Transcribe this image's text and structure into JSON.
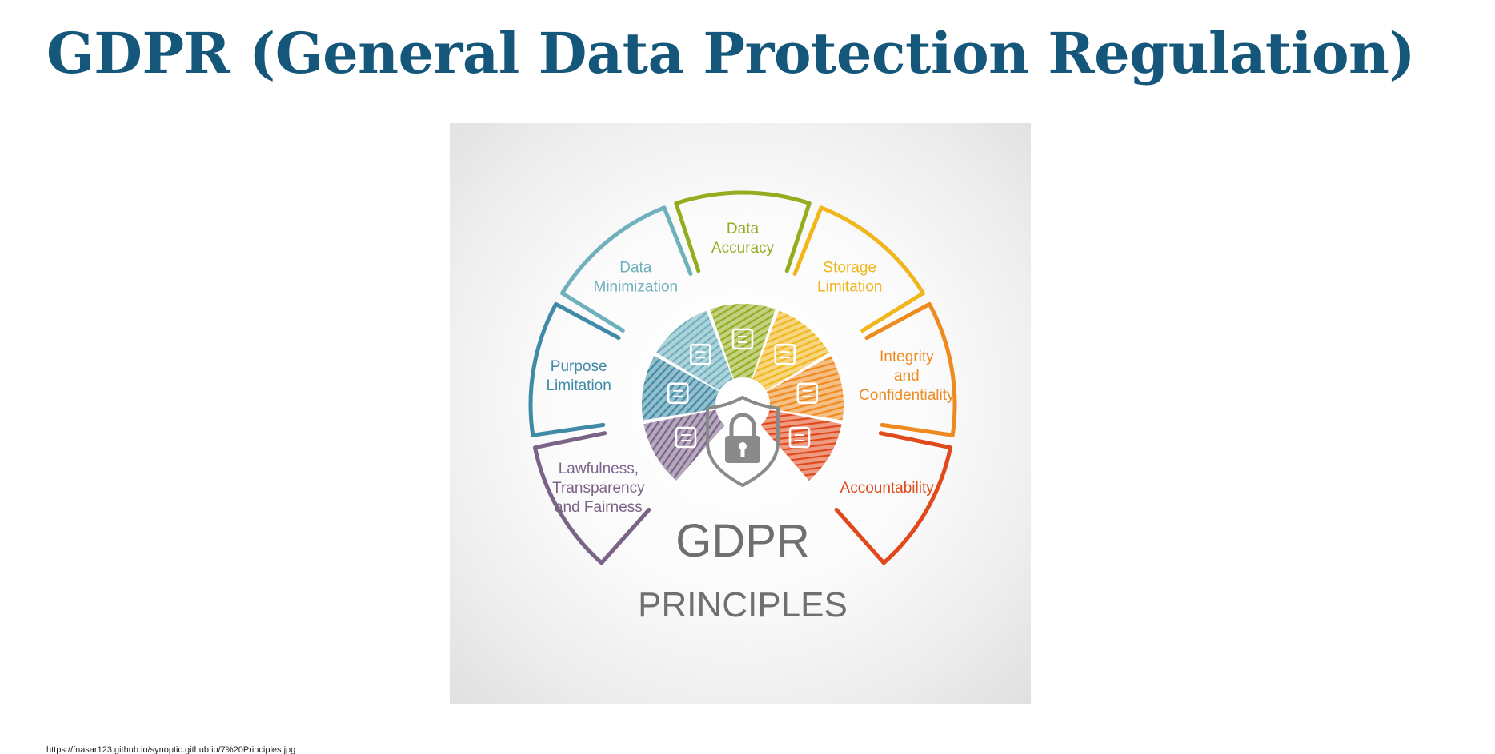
{
  "slide": {
    "title": "GDPR (General Data Protection Regulation)",
    "source_url": "https://fnasar123.github.io/synoptic.github.io/7%20Principles.jpg"
  },
  "figure": {
    "center_title": "GDPR",
    "center_subtitle": "PRINCIPLES",
    "segments": [
      {
        "label_lines": [
          "Lawfulness,",
          "Transparency",
          "and Fairness"
        ],
        "color": "#7b6388",
        "icon": "gavel-icon"
      },
      {
        "label_lines": [
          "Purpose",
          "Limitation"
        ],
        "color": "#3f8aa6",
        "icon": "clipboard-icon"
      },
      {
        "label_lines": [
          "Data",
          "Minimization"
        ],
        "color": "#6fb0bd",
        "icon": "storage-icon"
      },
      {
        "label_lines": [
          "Data",
          "Accuracy"
        ],
        "color": "#94ad1f",
        "icon": "target-icon"
      },
      {
        "label_lines": [
          "Storage",
          "Limitation"
        ],
        "color": "#f0b61c",
        "icon": "calendar-clock-icon"
      },
      {
        "label_lines": [
          "Integrity",
          "and",
          "Confidentiality"
        ],
        "color": "#ee8a1f",
        "icon": "lock-icon"
      },
      {
        "label_lines": [
          "Accountability"
        ],
        "color": "#e0491b",
        "icon": "people-icon"
      }
    ]
  }
}
